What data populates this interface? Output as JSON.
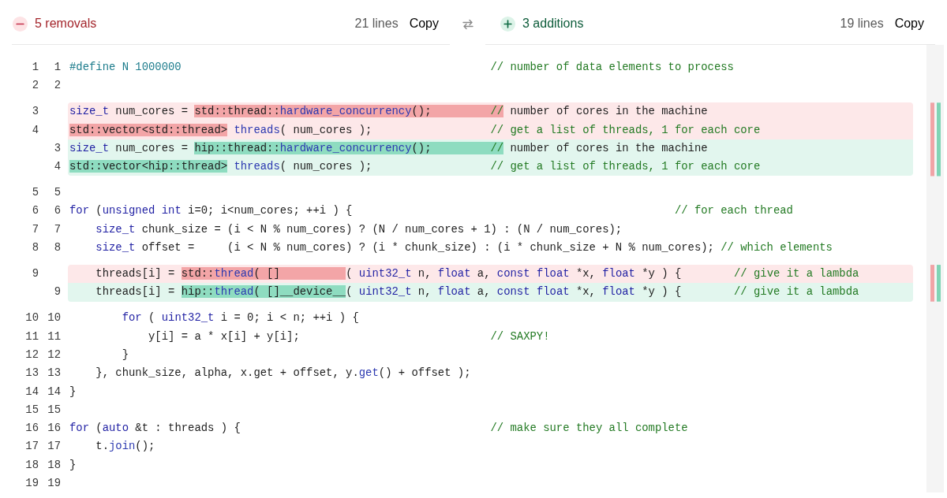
{
  "panes": [
    {
      "kind": "removed",
      "summary": "5 removals",
      "line_count": "21 lines",
      "copy": "Copy"
    },
    {
      "kind": "added",
      "summary": "3 additions",
      "line_count": "19 lines",
      "copy": "Copy"
    }
  ],
  "lines": [
    {
      "old": "1",
      "new": "1",
      "kind": "context",
      "tokens": [
        {
          "kind": "preproc",
          "text": "#define N 1000000"
        },
        {
          "kind": "comment",
          "text": "                                               // number of data elements to process"
        }
      ]
    },
    {
      "old": "2",
      "new": "2",
      "kind": "context"
    },
    {
      "old": "3",
      "kind": "removed",
      "tokens": [
        {
          "kind": "keyword",
          "text": "size_t",
          "changed": false
        },
        {
          "kind": "plain",
          "text": " num_cores = ",
          "changed": false
        },
        {
          "kind": "plain",
          "text": "std::thread::",
          "changed": true
        },
        {
          "kind": "func",
          "text": "hardware_concurrency",
          "changed": true
        },
        {
          "kind": "plain",
          "text": "();",
          "changed": true
        },
        {
          "kind": "comment",
          "text": "         //",
          "changed": true
        },
        {
          "kind": "plain",
          "text": " number of cores in the machine",
          "changed": false
        }
      ]
    },
    {
      "old": "4",
      "kind": "removed",
      "tokens": [
        {
          "kind": "plain",
          "text": "std::vector<std::thread>",
          "changed": true
        },
        {
          "kind": "func",
          "text": " threads",
          "changed": false
        },
        {
          "kind": "plain",
          "text": "( num_cores );",
          "changed": false
        },
        {
          "kind": "comment",
          "text": "                  // get a list of threads, 1 for each core",
          "changed": false
        }
      ]
    },
    {
      "new": "3",
      "kind": "added",
      "tokens": [
        {
          "kind": "keyword",
          "text": "size_t",
          "changed": false
        },
        {
          "kind": "plain",
          "text": " num_cores = ",
          "changed": false
        },
        {
          "kind": "plain",
          "text": "hip::thread::",
          "changed": true
        },
        {
          "kind": "func",
          "text": "hardware_concurrency",
          "changed": true
        },
        {
          "kind": "plain",
          "text": "();",
          "changed": true
        },
        {
          "kind": "comment",
          "text": "         //",
          "changed": true
        },
        {
          "kind": "plain",
          "text": " number of cores in the machine",
          "changed": false
        }
      ]
    },
    {
      "new": "4",
      "kind": "added",
      "tokens": [
        {
          "kind": "plain",
          "text": "std::vector<hip::thread>",
          "changed": true
        },
        {
          "kind": "func",
          "text": " threads",
          "changed": false
        },
        {
          "kind": "plain",
          "text": "( num_cores );",
          "changed": false
        },
        {
          "kind": "comment",
          "text": "                  // get a list of threads, 1 for each core",
          "changed": false
        }
      ]
    },
    {
      "old": "5",
      "new": "5",
      "kind": "context"
    },
    {
      "old": "6",
      "new": "6",
      "kind": "context",
      "tokens": [
        {
          "kind": "keyword",
          "text": "for"
        },
        {
          "kind": "plain",
          "text": " ("
        },
        {
          "kind": "keyword",
          "text": "unsigned int"
        },
        {
          "kind": "plain",
          "text": " i=0; i<num_cores; ++i ) {"
        },
        {
          "kind": "comment",
          "text": "                                                 // for each thread"
        }
      ]
    },
    {
      "old": "7",
      "new": "7",
      "kind": "context",
      "tokens": [
        {
          "kind": "keyword",
          "text": "    size_t"
        },
        {
          "kind": "plain",
          "text": " chunk_size = (i < N % num_cores) ? (N / num_cores + 1) : (N / num_cores);"
        }
      ]
    },
    {
      "old": "8",
      "new": "8",
      "kind": "context",
      "tokens": [
        {
          "kind": "keyword",
          "text": "    size_t"
        },
        {
          "kind": "plain",
          "text": " offset =     (i < N % num_cores) ? (i * chunk_size) : (i * chunk_size + N % num_cores);"
        },
        {
          "kind": "comment",
          "text": " // which elements"
        }
      ]
    },
    {
      "old": "9",
      "kind": "removed",
      "tokens": [
        {
          "kind": "plain",
          "text": "    threads[i] = ",
          "changed": false
        },
        {
          "kind": "plain",
          "text": "std::",
          "changed": true
        },
        {
          "kind": "func",
          "text": "thread",
          "changed": true
        },
        {
          "kind": "plain",
          "text": "( []          ",
          "changed": true
        },
        {
          "kind": "plain",
          "text": "( ",
          "changed": false
        },
        {
          "kind": "keyword",
          "text": "uint32_t",
          "changed": false
        },
        {
          "kind": "plain",
          "text": " n, ",
          "changed": false
        },
        {
          "kind": "keyword",
          "text": "float",
          "changed": false
        },
        {
          "kind": "plain",
          "text": " a, ",
          "changed": false
        },
        {
          "kind": "keyword",
          "text": "const",
          "changed": false
        },
        {
          "kind": "keyword",
          "text": " float",
          "changed": false
        },
        {
          "kind": "plain",
          "text": " *x, ",
          "changed": false
        },
        {
          "kind": "keyword",
          "text": "float",
          "changed": false
        },
        {
          "kind": "plain",
          "text": " *y ) {",
          "changed": false
        },
        {
          "kind": "comment",
          "text": "        // give it a lambda",
          "changed": false
        }
      ]
    },
    {
      "new": "9",
      "kind": "added",
      "tokens": [
        {
          "kind": "plain",
          "text": "    threads[i] = ",
          "changed": false
        },
        {
          "kind": "plain",
          "text": "hip::",
          "changed": true
        },
        {
          "kind": "func",
          "text": "thread",
          "changed": true
        },
        {
          "kind": "plain",
          "text": "( []__device__",
          "changed": true
        },
        {
          "kind": "plain",
          "text": "( ",
          "changed": false
        },
        {
          "kind": "keyword",
          "text": "uint32_t",
          "changed": false
        },
        {
          "kind": "plain",
          "text": " n, ",
          "changed": false
        },
        {
          "kind": "keyword",
          "text": "float",
          "changed": false
        },
        {
          "kind": "plain",
          "text": " a, ",
          "changed": false
        },
        {
          "kind": "keyword",
          "text": "const",
          "changed": false
        },
        {
          "kind": "keyword",
          "text": " float",
          "changed": false
        },
        {
          "kind": "plain",
          "text": " *x, ",
          "changed": false
        },
        {
          "kind": "keyword",
          "text": "float",
          "changed": false
        },
        {
          "kind": "plain",
          "text": " *y ) {",
          "changed": false
        },
        {
          "kind": "comment",
          "text": "        // give it a lambda",
          "changed": false
        }
      ]
    },
    {
      "old": "10",
      "new": "10",
      "kind": "context",
      "tokens": [
        {
          "kind": "keyword",
          "text": "        for"
        },
        {
          "kind": "plain",
          "text": " ( "
        },
        {
          "kind": "keyword",
          "text": "uint32_t"
        },
        {
          "kind": "plain",
          "text": " i = 0; i < n; ++i ) {"
        }
      ]
    },
    {
      "old": "11",
      "new": "11",
      "kind": "context",
      "tokens": [
        {
          "kind": "plain",
          "text": "            y[i] = a * x[i] + y[i];"
        },
        {
          "kind": "comment",
          "text": "                             // SAXPY!"
        }
      ]
    },
    {
      "old": "12",
      "new": "12",
      "kind": "context",
      "tokens": [
        {
          "kind": "plain",
          "text": "        }"
        }
      ]
    },
    {
      "old": "13",
      "new": "13",
      "kind": "context",
      "tokens": [
        {
          "kind": "plain",
          "text": "    }, chunk_size, alpha, x.get + offset, y."
        },
        {
          "kind": "func",
          "text": "get"
        },
        {
          "kind": "plain",
          "text": "() + offset );"
        }
      ]
    },
    {
      "old": "14",
      "new": "14",
      "kind": "context",
      "tokens": [
        {
          "kind": "plain",
          "text": "}"
        }
      ]
    },
    {
      "old": "15",
      "new": "15",
      "kind": "context"
    },
    {
      "old": "16",
      "new": "16",
      "kind": "context",
      "tokens": [
        {
          "kind": "keyword",
          "text": "for"
        },
        {
          "kind": "plain",
          "text": " ("
        },
        {
          "kind": "keyword",
          "text": "auto"
        },
        {
          "kind": "plain",
          "text": " &t : threads ) {"
        },
        {
          "kind": "comment",
          "text": "                                      // make sure they all complete"
        }
      ]
    },
    {
      "old": "17",
      "new": "17",
      "kind": "context",
      "tokens": [
        {
          "kind": "plain",
          "text": "    t."
        },
        {
          "kind": "func",
          "text": "join"
        },
        {
          "kind": "plain",
          "text": "();"
        }
      ]
    },
    {
      "old": "18",
      "new": "18",
      "kind": "context",
      "tokens": [
        {
          "kind": "plain",
          "text": "}"
        }
      ]
    },
    {
      "old": "19",
      "new": "19",
      "kind": "context"
    }
  ]
}
